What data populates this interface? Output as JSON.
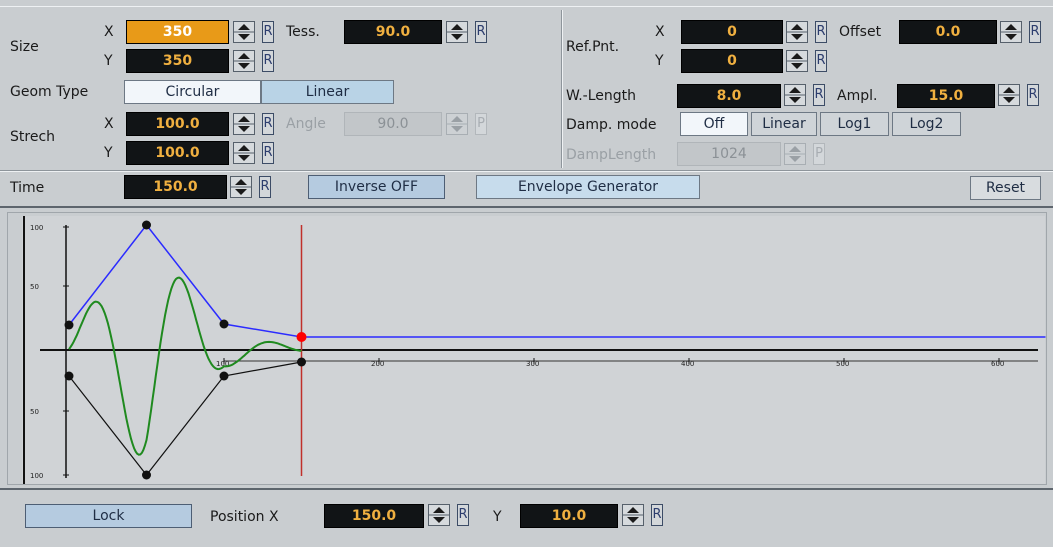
{
  "size": {
    "label": "Size",
    "x_label": "X",
    "x_value": "350",
    "y_label": "Y",
    "y_value": "350"
  },
  "tess": {
    "label": "Tess.",
    "value": "90.0"
  },
  "geom_type": {
    "label": "Geom Type",
    "options": [
      "Circular",
      "Linear"
    ],
    "selected": "Circular"
  },
  "strech": {
    "label": "Strech",
    "x_label": "X",
    "x_value": "100.0",
    "y_label": "Y",
    "y_value": "100.0"
  },
  "angle": {
    "label": "Angle",
    "value": "90.0",
    "disabled": true
  },
  "ref_pnt": {
    "label": "Ref.Pnt.",
    "x_label": "X",
    "x_value": "0",
    "y_label": "Y",
    "y_value": "0"
  },
  "offset": {
    "label": "Offset",
    "value": "0.0"
  },
  "wlength": {
    "label": "W.-Length",
    "value": "8.0"
  },
  "ampl": {
    "label": "Ampl.",
    "value": "15.0"
  },
  "damp_mode": {
    "label": "Damp. mode",
    "options": [
      "Off",
      "Linear",
      "Log1",
      "Log2"
    ],
    "selected": "Off"
  },
  "damp_length": {
    "label": "DampLength",
    "value": "1024",
    "disabled": true
  },
  "time": {
    "label": "Time",
    "value": "150.0"
  },
  "inverse_button": "Inverse OFF",
  "envelope_button": "Envelope Generator",
  "reset_button": "Reset",
  "reset_char": "R",
  "reset_char_dis": "P",
  "graph": {
    "y_tick_labels": [
      "100",
      "50",
      "50",
      "100"
    ],
    "x_tick_labels": [
      "100",
      "200",
      "300",
      "400",
      "500",
      "600"
    ],
    "colors": {
      "envelope_upper": "#2b2bff",
      "envelope_lower": "#111111",
      "wave": "#1f8a1f",
      "cursor": "#c0302b",
      "active_point": "#ff0000"
    }
  },
  "lock_button": "Lock",
  "position": {
    "label": "Position X",
    "x_value": "150.0",
    "y_label": "Y",
    "y_value": "10.0"
  }
}
